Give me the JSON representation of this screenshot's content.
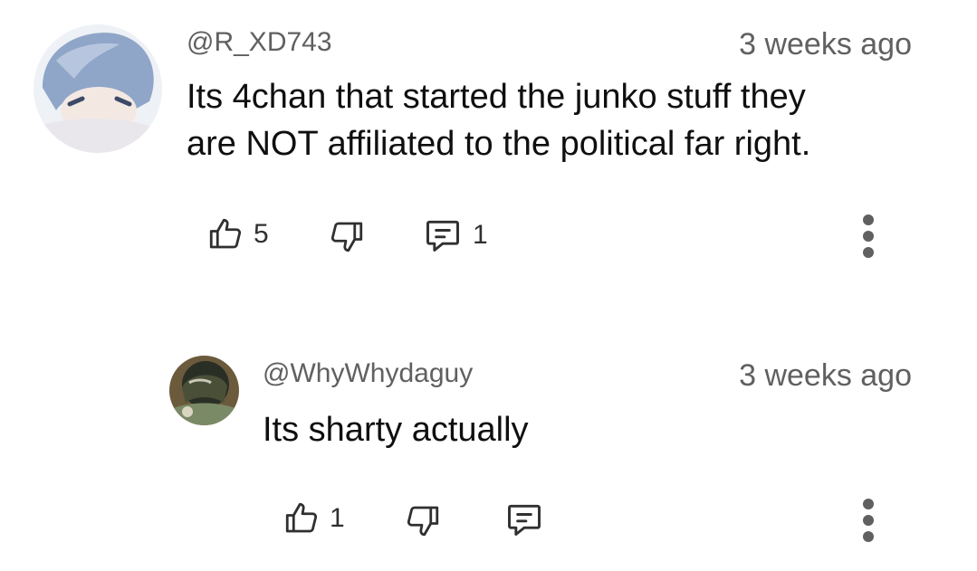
{
  "comments": [
    {
      "username": "@R_XD743",
      "timestamp": "3 weeks ago",
      "text_lines": [
        "Its 4chan that started the junko stuff they",
        "are NOT affiliated to the political far right."
      ],
      "likes": "5",
      "replies": "1",
      "icons": {
        "like": "thumbs-up-icon",
        "dislike": "thumbs-down-icon",
        "reply": "comment-icon",
        "more": "more-vertical-icon"
      },
      "avatar_colors": [
        "#dfe6f0",
        "#8fa6c8",
        "#f3e7e2"
      ]
    },
    {
      "username": "@WhyWhydaguy",
      "timestamp": "3 weeks ago",
      "text_lines": [
        "Its sharty actually"
      ],
      "likes": "1",
      "replies": "",
      "icons": {
        "like": "thumbs-up-icon",
        "dislike": "thumbs-down-icon",
        "reply": "comment-icon",
        "more": "more-vertical-icon"
      },
      "avatar_colors": [
        "#6b5a3c",
        "#2f3a2a",
        "#8a9a7a"
      ]
    }
  ],
  "colors": {
    "secondary_text": "#606060",
    "primary_text": "#0f0f0f",
    "icon": "#303030"
  }
}
